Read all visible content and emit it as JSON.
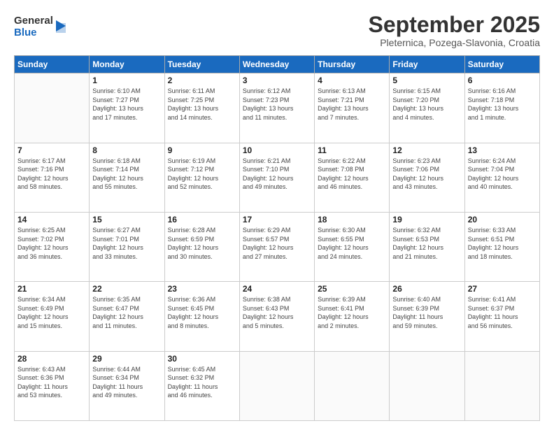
{
  "logo": {
    "general": "General",
    "blue": "Blue"
  },
  "title": "September 2025",
  "location": "Pleternica, Pozega-Slavonia, Croatia",
  "days_header": [
    "Sunday",
    "Monday",
    "Tuesday",
    "Wednesday",
    "Thursday",
    "Friday",
    "Saturday"
  ],
  "weeks": [
    [
      {
        "day": "",
        "info": ""
      },
      {
        "day": "1",
        "info": "Sunrise: 6:10 AM\nSunset: 7:27 PM\nDaylight: 13 hours\nand 17 minutes."
      },
      {
        "day": "2",
        "info": "Sunrise: 6:11 AM\nSunset: 7:25 PM\nDaylight: 13 hours\nand 14 minutes."
      },
      {
        "day": "3",
        "info": "Sunrise: 6:12 AM\nSunset: 7:23 PM\nDaylight: 13 hours\nand 11 minutes."
      },
      {
        "day": "4",
        "info": "Sunrise: 6:13 AM\nSunset: 7:21 PM\nDaylight: 13 hours\nand 7 minutes."
      },
      {
        "day": "5",
        "info": "Sunrise: 6:15 AM\nSunset: 7:20 PM\nDaylight: 13 hours\nand 4 minutes."
      },
      {
        "day": "6",
        "info": "Sunrise: 6:16 AM\nSunset: 7:18 PM\nDaylight: 13 hours\nand 1 minute."
      }
    ],
    [
      {
        "day": "7",
        "info": "Sunrise: 6:17 AM\nSunset: 7:16 PM\nDaylight: 12 hours\nand 58 minutes."
      },
      {
        "day": "8",
        "info": "Sunrise: 6:18 AM\nSunset: 7:14 PM\nDaylight: 12 hours\nand 55 minutes."
      },
      {
        "day": "9",
        "info": "Sunrise: 6:19 AM\nSunset: 7:12 PM\nDaylight: 12 hours\nand 52 minutes."
      },
      {
        "day": "10",
        "info": "Sunrise: 6:21 AM\nSunset: 7:10 PM\nDaylight: 12 hours\nand 49 minutes."
      },
      {
        "day": "11",
        "info": "Sunrise: 6:22 AM\nSunset: 7:08 PM\nDaylight: 12 hours\nand 46 minutes."
      },
      {
        "day": "12",
        "info": "Sunrise: 6:23 AM\nSunset: 7:06 PM\nDaylight: 12 hours\nand 43 minutes."
      },
      {
        "day": "13",
        "info": "Sunrise: 6:24 AM\nSunset: 7:04 PM\nDaylight: 12 hours\nand 40 minutes."
      }
    ],
    [
      {
        "day": "14",
        "info": "Sunrise: 6:25 AM\nSunset: 7:02 PM\nDaylight: 12 hours\nand 36 minutes."
      },
      {
        "day": "15",
        "info": "Sunrise: 6:27 AM\nSunset: 7:01 PM\nDaylight: 12 hours\nand 33 minutes."
      },
      {
        "day": "16",
        "info": "Sunrise: 6:28 AM\nSunset: 6:59 PM\nDaylight: 12 hours\nand 30 minutes."
      },
      {
        "day": "17",
        "info": "Sunrise: 6:29 AM\nSunset: 6:57 PM\nDaylight: 12 hours\nand 27 minutes."
      },
      {
        "day": "18",
        "info": "Sunrise: 6:30 AM\nSunset: 6:55 PM\nDaylight: 12 hours\nand 24 minutes."
      },
      {
        "day": "19",
        "info": "Sunrise: 6:32 AM\nSunset: 6:53 PM\nDaylight: 12 hours\nand 21 minutes."
      },
      {
        "day": "20",
        "info": "Sunrise: 6:33 AM\nSunset: 6:51 PM\nDaylight: 12 hours\nand 18 minutes."
      }
    ],
    [
      {
        "day": "21",
        "info": "Sunrise: 6:34 AM\nSunset: 6:49 PM\nDaylight: 12 hours\nand 15 minutes."
      },
      {
        "day": "22",
        "info": "Sunrise: 6:35 AM\nSunset: 6:47 PM\nDaylight: 12 hours\nand 11 minutes."
      },
      {
        "day": "23",
        "info": "Sunrise: 6:36 AM\nSunset: 6:45 PM\nDaylight: 12 hours\nand 8 minutes."
      },
      {
        "day": "24",
        "info": "Sunrise: 6:38 AM\nSunset: 6:43 PM\nDaylight: 12 hours\nand 5 minutes."
      },
      {
        "day": "25",
        "info": "Sunrise: 6:39 AM\nSunset: 6:41 PM\nDaylight: 12 hours\nand 2 minutes."
      },
      {
        "day": "26",
        "info": "Sunrise: 6:40 AM\nSunset: 6:39 PM\nDaylight: 11 hours\nand 59 minutes."
      },
      {
        "day": "27",
        "info": "Sunrise: 6:41 AM\nSunset: 6:37 PM\nDaylight: 11 hours\nand 56 minutes."
      }
    ],
    [
      {
        "day": "28",
        "info": "Sunrise: 6:43 AM\nSunset: 6:36 PM\nDaylight: 11 hours\nand 53 minutes."
      },
      {
        "day": "29",
        "info": "Sunrise: 6:44 AM\nSunset: 6:34 PM\nDaylight: 11 hours\nand 49 minutes."
      },
      {
        "day": "30",
        "info": "Sunrise: 6:45 AM\nSunset: 6:32 PM\nDaylight: 11 hours\nand 46 minutes."
      },
      {
        "day": "",
        "info": ""
      },
      {
        "day": "",
        "info": ""
      },
      {
        "day": "",
        "info": ""
      },
      {
        "day": "",
        "info": ""
      }
    ]
  ]
}
